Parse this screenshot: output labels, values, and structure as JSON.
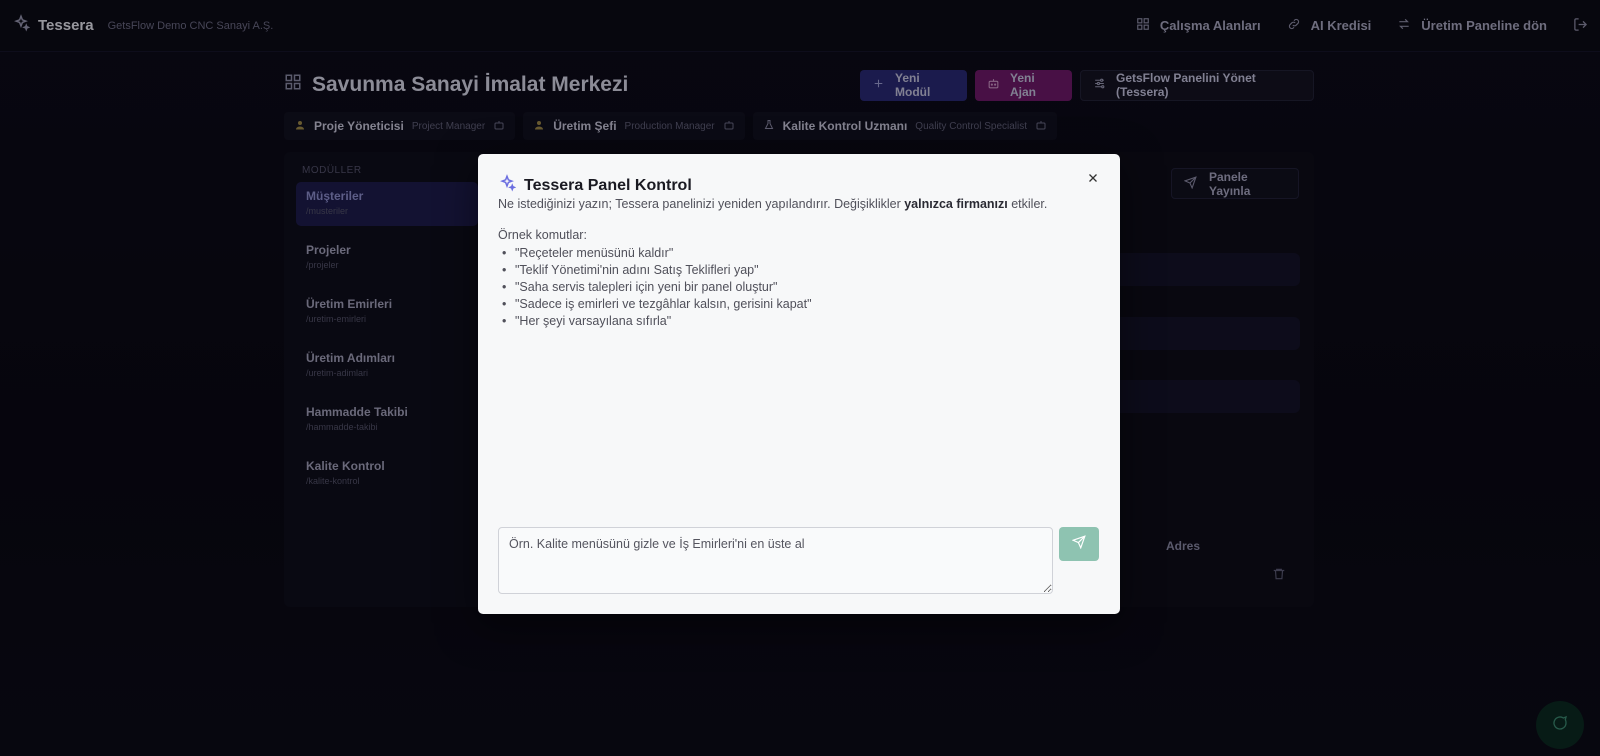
{
  "topbar": {
    "brand": "Tessera",
    "company": "GetsFlow Demo CNC Sanayi A.Ş.",
    "links": [
      "Çalışma Alanları",
      "AI Kredisi",
      "Üretim Paneline dön"
    ]
  },
  "page": {
    "title": "Savunma Sanayi İmalat Merkezi",
    "actions": {
      "new_module": "Yeni Modül",
      "new_agent": "Yeni Ajan",
      "manage": "GetsFlow Panelini Yönet (Tessera)"
    },
    "roles": [
      {
        "name": "Proje Yöneticisi",
        "en": "Project Manager"
      },
      {
        "name": "Üretim Şefi",
        "en": "Production Manager"
      },
      {
        "name": "Kalite Kontrol Uzmanı",
        "en": "Quality Control Specialist"
      }
    ]
  },
  "sidebar": {
    "title": "MODÜLLER",
    "items": [
      {
        "label": "Müşteriler",
        "path": "/musteriler"
      },
      {
        "label": "Projeler",
        "path": "/projeler"
      },
      {
        "label": "Üretim Emirleri",
        "path": "/uretim-emirleri"
      },
      {
        "label": "Üretim Adımları",
        "path": "/uretim-adimlari"
      },
      {
        "label": "Hammadde Takibi",
        "path": "/hammadde-takibi"
      },
      {
        "label": "Kalite Kontrol",
        "path": "/kalite-kontrol"
      }
    ]
  },
  "main": {
    "publish": "Panele Yayınla",
    "column": "Adres"
  },
  "modal": {
    "title": "Tessera Panel Kontrol",
    "desc_before": "Ne istediğinizi yazın; Tessera panelinizi yeniden yapılandırır. Değişiklikler ",
    "desc_bold": "yalnızca firmanızı",
    "desc_after": " etkiler.",
    "examples_title": "Örnek komutlar:",
    "examples": [
      "\"Reçeteler menüsünü kaldır\"",
      "\"Teklif Yönetimi'nin adını Satış Teklifleri yap\"",
      "\"Saha servis talepleri için yeni bir panel oluştur\"",
      "\"Sadece iş emirleri ve tezgâhlar kalsın, gerisini kapat\"",
      "\"Her şeyi varsayılana sıfırla\""
    ],
    "input_placeholder": "Örn. Kalite menüsünü gizle ve İş Emirleri'ni en üste al",
    "input_value": ""
  },
  "colors": {
    "accent_module": "#2a2a77",
    "accent_agent": "#6f1a6a",
    "send_button": "#8ec3b1",
    "icon_purple": "#6b6ee0"
  }
}
